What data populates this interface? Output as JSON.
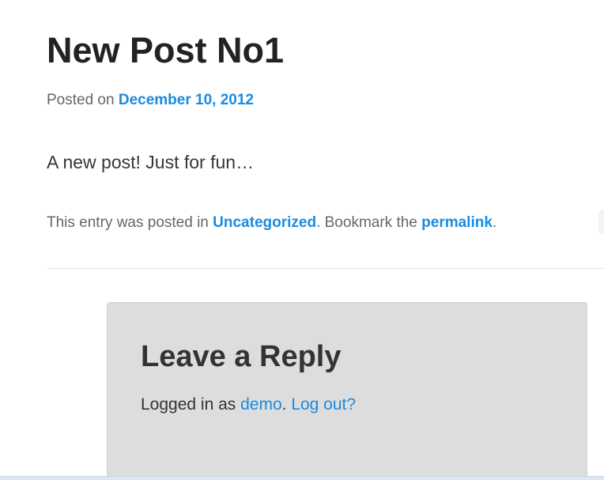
{
  "post": {
    "title": "New Post No1",
    "posted_on_prefix": "Posted on ",
    "date": "December 10, 2012",
    "content": "A new post! Just for fun…",
    "footer": {
      "prefix": "This entry was posted in ",
      "category": "Uncategorized",
      "middle": ". Bookmark the ",
      "permalink": "permalink",
      "suffix": "."
    }
  },
  "reply": {
    "title": "Leave a Reply",
    "logged_in_prefix": "Logged in as ",
    "user": "demo",
    "separator": ". ",
    "logout": "Log out?"
  },
  "colors": {
    "link": "#1b8be0",
    "title": "#222222",
    "meta": "#666666",
    "reply_bg": "#dddddd"
  }
}
